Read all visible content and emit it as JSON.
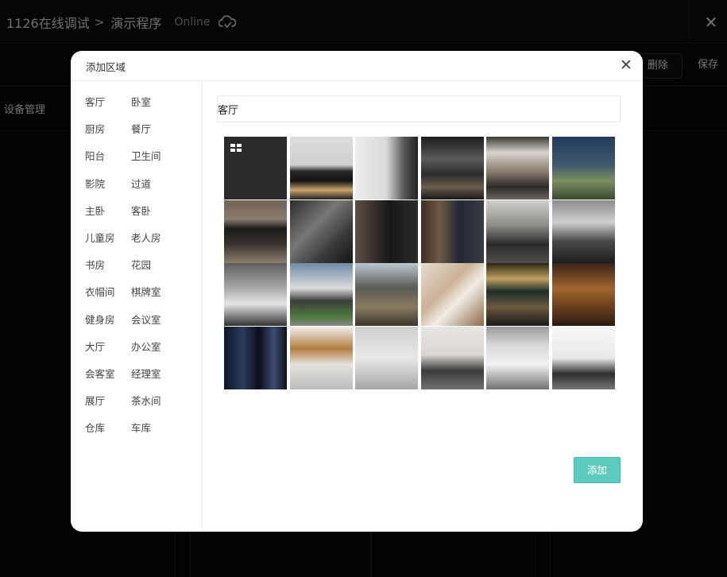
{
  "header": {
    "project": "1126在线调试",
    "separator": ">",
    "program": "演示程序",
    "status": "Online",
    "close_icon": "close-icon",
    "cloud_icon": "cloud-sync-icon"
  },
  "toolbar": {
    "delete_label": "删除",
    "save_label": "保存"
  },
  "subnav": {
    "label": "设备管理"
  },
  "modal": {
    "title": "添加区域",
    "name_value": "客厅",
    "add_label": "添加",
    "accent": "#5ecbbf",
    "room_types": [
      "客厅",
      "卧室",
      "厨房",
      "餐厅",
      "阳台",
      "卫生间",
      "影院",
      "过道",
      "主卧",
      "客卧",
      "儿童房",
      "老人房",
      "书房",
      "花园",
      "衣帽间",
      "棋牌室",
      "健身房",
      "会议室",
      "大厅",
      "办公室",
      "会客室",
      "经理室",
      "展厅",
      "茶水间",
      "仓库",
      "车库"
    ],
    "images": [
      "default-area-icon",
      "bedroom-image",
      "minimal-bedroom-image",
      "dining-room-image",
      "kitchen-image",
      "garden-night-image",
      "living-room-tv-image",
      "gym-image",
      "dark-hallway-image",
      "study-image",
      "grey-bedroom-image",
      "bathroom-image",
      "white-living-room-image",
      "villa-exterior-image",
      "patio-image",
      "staircase-image",
      "home-theater-image",
      "wine-cellar-image",
      "server-room-image",
      "laundry-image",
      "grey-room-image",
      "kitchen-pendants-image",
      "office-shelves-image",
      "white-stair-image"
    ]
  }
}
